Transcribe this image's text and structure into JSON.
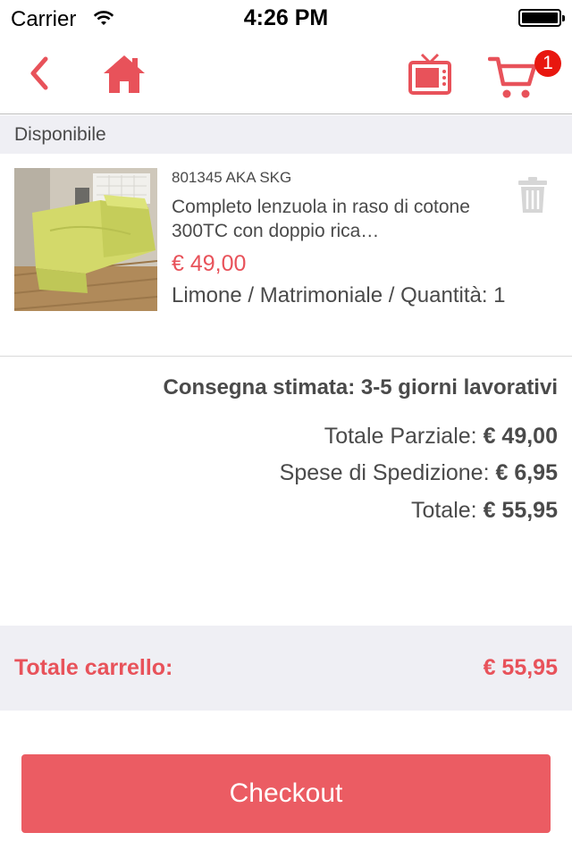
{
  "status_bar": {
    "carrier": "Carrier",
    "time": "4:26 PM"
  },
  "nav": {
    "back_icon": "chevron-left-icon",
    "home_icon": "home-icon",
    "tv_icon": "tv-icon",
    "cart_icon": "cart-icon",
    "cart_badge": "1"
  },
  "section": {
    "title": "Disponibile"
  },
  "product": {
    "sku": "801345 AKA SKG",
    "title": "Completo lenzuola in raso di cotone 300TC con doppio rica…",
    "price": "€ 49,00",
    "variant": "Limone / Matrimoniale / Quantità: 1",
    "image_alt": "bed with lime green sheets",
    "delete_icon": "trash-icon"
  },
  "summary": {
    "delivery": "Consegna stimata: 3-5 giorni lavorativi",
    "subtotal_label": "Totale Parziale:",
    "subtotal_value": "€ 49,00",
    "shipping_label": "Spese di Spedizione:",
    "shipping_value": "€ 6,95",
    "total_label": "Totale:",
    "total_value": "€ 55,95"
  },
  "cart_total": {
    "label": "Totale carrello:",
    "value": "€ 55,95"
  },
  "checkout": {
    "label": "Checkout"
  },
  "colors": {
    "accent": "#e8525a",
    "button": "#eb5c63",
    "section_bg": "#efeff4",
    "text": "#4a4a4a",
    "badge": "#e8170f"
  }
}
